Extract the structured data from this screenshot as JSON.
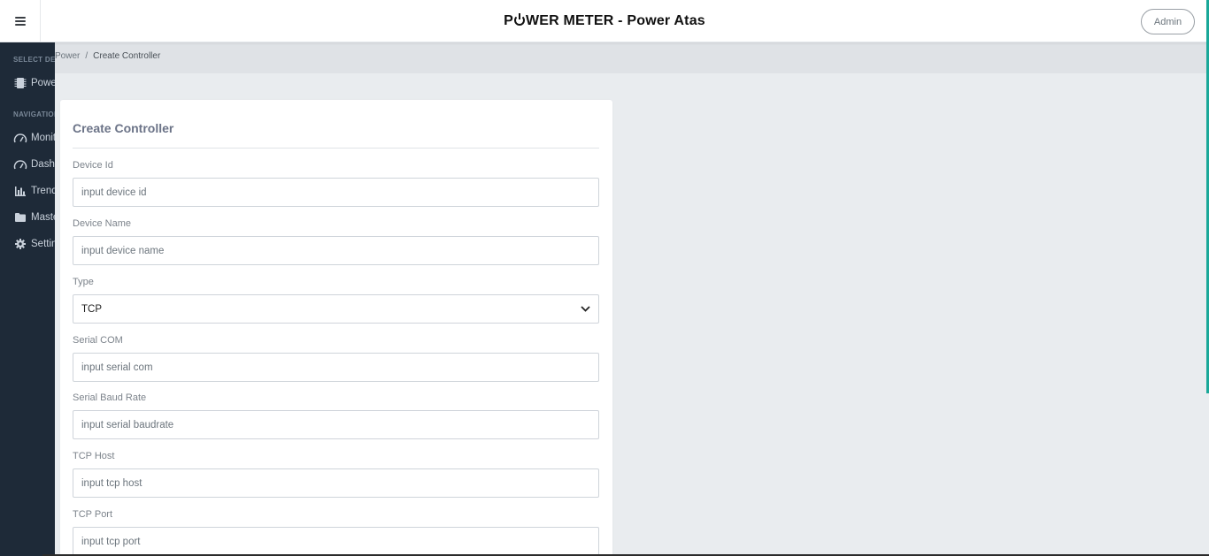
{
  "header": {
    "title_pre": "P",
    "title_post": "WER METER - Power Atas",
    "admin_label": "Admin"
  },
  "sidebar": {
    "select_device_heading": "SELECT DEVICE",
    "device_label": "Power",
    "navigation_heading": "NAVIGATION",
    "items": [
      {
        "label": "Monitoring",
        "icon": "gauge-icon"
      },
      {
        "label": "Dashboard",
        "icon": "gauge-icon"
      },
      {
        "label": "Trend",
        "icon": "bar-chart-icon"
      },
      {
        "label": "Master",
        "icon": "folder-icon"
      },
      {
        "label": "Setting",
        "icon": "gear-icon"
      }
    ]
  },
  "breadcrumb": {
    "parent": "Power",
    "separator": "/",
    "current": "Create Controller"
  },
  "form": {
    "title": "Create Controller",
    "fields": [
      {
        "label": "Device Id",
        "placeholder": "input device id"
      },
      {
        "label": "Device Name",
        "placeholder": "input device name"
      },
      {
        "label": "Type",
        "value": "TCP"
      },
      {
        "label": "Serial COM",
        "placeholder": "input serial com"
      },
      {
        "label": "Serial Baud Rate",
        "placeholder": "input serial baudrate"
      },
      {
        "label": "TCP Host",
        "placeholder": "input tcp host"
      },
      {
        "label": "TCP Port",
        "placeholder": "input tcp port"
      }
    ]
  },
  "colors": {
    "sidebar_bg": "#1e2a38",
    "accent": "#1aa899",
    "card_title": "#6b7387"
  }
}
